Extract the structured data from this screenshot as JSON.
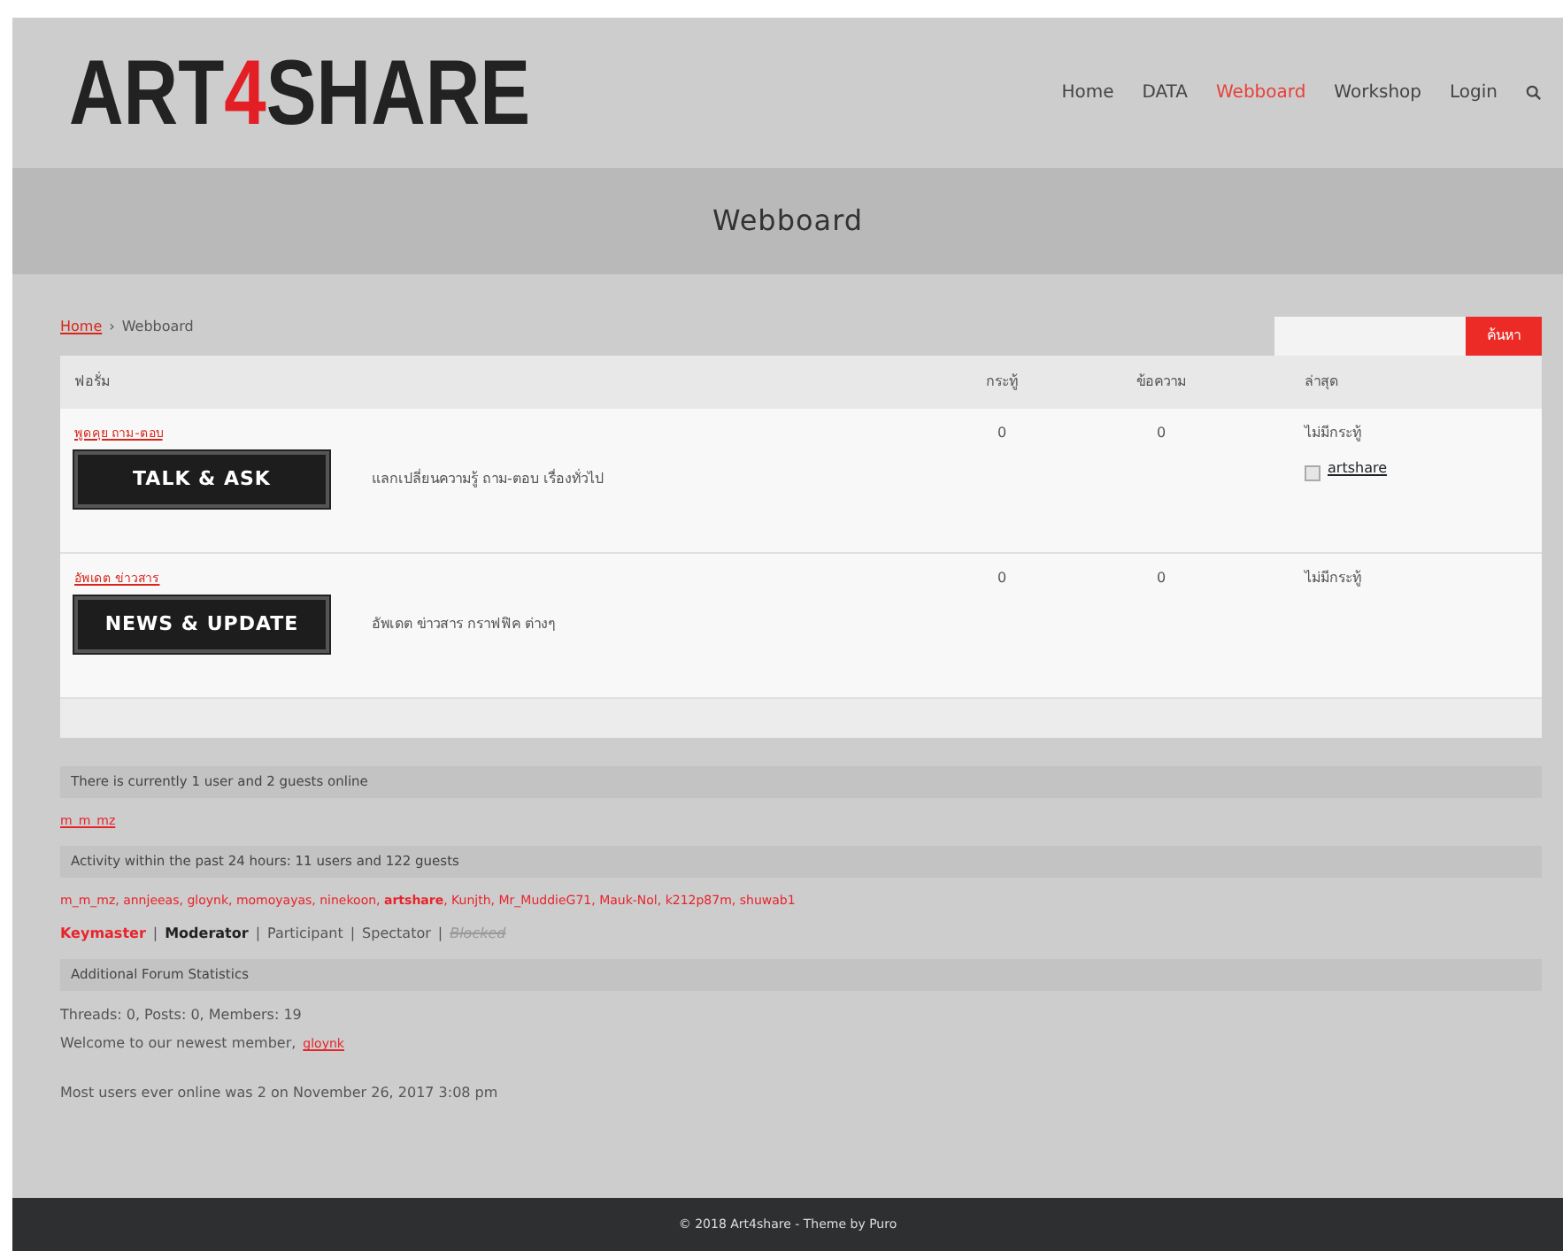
{
  "logo": {
    "parts": [
      {
        "text": "ART",
        "accent": false
      },
      {
        "text": "4",
        "accent": true
      },
      {
        "text": "SHARE",
        "accent": false
      }
    ]
  },
  "nav": [
    {
      "label": "Home",
      "selected": false
    },
    {
      "label": "DATA",
      "selected": false
    },
    {
      "label": "Webboard",
      "selected": true
    },
    {
      "label": "Workshop",
      "selected": false
    },
    {
      "label": "Login",
      "selected": false
    }
  ],
  "page_title": "Webboard",
  "breadcrumb": {
    "home": "Home",
    "separator": "›",
    "current": "Webboard"
  },
  "search": {
    "button": "ค้นหา"
  },
  "table": {
    "columns": [
      "ฟอรั่ม",
      "กระทู้",
      "ข้อความ",
      "ล่าสุด"
    ],
    "rows": [
      {
        "title": "พูดคุย ถาม-ตอบ",
        "banner": "TALK & ASK",
        "description": "แลกเปลี่ยนความรู้ ถาม-ตอบ เรื่องทั่วไป",
        "topics": "0",
        "posts": "0",
        "latest": "ไม่มีกระทู้",
        "latest_user": "artshare"
      },
      {
        "title": "อัพเดต ข่าวสาร",
        "banner": "NEWS & UPDATE",
        "description": "อัพเดต ข่าวสาร กราฟฟิค ต่างๆ",
        "topics": "0",
        "posts": "0",
        "latest": "ไม่มีกระทู้"
      }
    ]
  },
  "stats": {
    "online_heading": "There is currently 1 user and 2 guests online",
    "online_users": "m_m_mz",
    "activity_heading": "Activity within the past 24 hours: 11 users and 122 guests",
    "activity_users": "m_m_mz, annjeeas, gloynk, momoyayas, ninekoon, **artshare**, Kunjth, Mr_MuddieG71, Mauk-Nol, k212p87m, shuwab1",
    "roles": [
      {
        "label": "Keymaster",
        "kind": "keymaster"
      },
      {
        "label": "Moderator",
        "kind": "moderator"
      },
      {
        "label": "Participant",
        "kind": "plain"
      },
      {
        "label": "Spectator",
        "kind": "plain"
      },
      {
        "label": "Blocked",
        "kind": "blocked"
      }
    ],
    "role_separator": "|",
    "additional_heading": "Additional Forum Statistics",
    "counts": "Threads: 0, Posts: 0, Members: 19",
    "welcome": "Welcome to our newest member,",
    "newest_member": "gloynk",
    "record": "Most users ever online was 2 on November 26, 2017 3:08 pm"
  },
  "footer": "© 2018 Art4share - Theme by Puro"
}
